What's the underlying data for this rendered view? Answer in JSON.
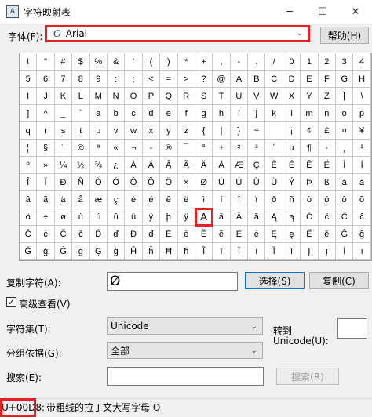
{
  "window": {
    "title": "字符映射表",
    "minimize": "─",
    "maximize": "☐",
    "close": "✕"
  },
  "font": {
    "label": "字体(F):",
    "icon_glyph": "O",
    "value": "Arial",
    "help_button": "帮助(H)"
  },
  "grid": {
    "selected_row": 9,
    "selected_col": 10,
    "rows": [
      [
        "!",
        "\"",
        "#",
        "$",
        "%",
        "&",
        "'",
        "(",
        ")",
        "*",
        "+",
        ",",
        "-",
        ".",
        "/",
        "0",
        "1",
        "2",
        "3",
        "4"
      ],
      [
        "5",
        "6",
        "7",
        "8",
        "9",
        ":",
        ";",
        "<",
        "=",
        ">",
        "?",
        "@",
        "A",
        "B",
        "C",
        "D",
        "E",
        "F",
        "G",
        "H"
      ],
      [
        "I",
        "J",
        "K",
        "L",
        "M",
        "N",
        "O",
        "P",
        "Q",
        "R",
        "S",
        "T",
        "U",
        "V",
        "W",
        "X",
        "Y",
        "Z",
        "[",
        "\\"
      ],
      [
        "]",
        "^",
        "_",
        "`",
        "a",
        "b",
        "c",
        "d",
        "e",
        "f",
        "g",
        "h",
        "i",
        "j",
        "k",
        "l",
        "m",
        "n",
        "o",
        "p"
      ],
      [
        "q",
        "r",
        "s",
        "t",
        "u",
        "v",
        "w",
        "x",
        "y",
        "z",
        "{",
        "|",
        "}",
        "~",
        " ",
        "¡",
        "¢",
        "£",
        "¤",
        "¥"
      ],
      [
        "¦",
        "§",
        "¨",
        "©",
        "ª",
        "«",
        "¬",
        "-",
        "®",
        "¯",
        "°",
        "±",
        "²",
        "³",
        "´",
        "µ",
        "¶",
        "·",
        "¸",
        "¹"
      ],
      [
        "º",
        "»",
        "¼",
        "½",
        "¾",
        "¿",
        "À",
        "Á",
        "Â",
        "Ã",
        "Ä",
        "Å",
        "Æ",
        "Ç",
        "È",
        "É",
        "Ê",
        "Ë",
        "Ì",
        "Í"
      ],
      [
        "Î",
        "Ï",
        "Ð",
        "Ñ",
        "Ò",
        "Ó",
        "Ô",
        "Õ",
        "Ö",
        "×",
        "Ø",
        "Ù",
        "Ú",
        "Û",
        "Ü",
        "Ý",
        "Þ",
        "ß",
        "à",
        "á"
      ],
      [
        "â",
        "ã",
        "ä",
        "å",
        "æ",
        "ç",
        "è",
        "é",
        "ê",
        "ë",
        "ì",
        "í",
        "î",
        "ï",
        "ð",
        "ñ",
        "ò",
        "ó",
        "ô",
        "õ"
      ],
      [
        "ö",
        "÷",
        "ø",
        "ù",
        "ú",
        "û",
        "ü",
        "ý",
        "þ",
        "ÿ",
        "Ā",
        "ā",
        "Ă",
        "ă",
        "Ą",
        "ą",
        "Ć",
        "ć",
        "Ĉ",
        "ĉ"
      ],
      [
        "Ċ",
        "ċ",
        "Č",
        "č",
        "Ď",
        "ď",
        "Đ",
        "đ",
        "Ē",
        "ē",
        "Ĕ",
        "ĕ",
        "Ė",
        "ė",
        "Ę",
        "ę",
        "Ě",
        "ě",
        "Ĝ",
        "ĝ"
      ],
      [
        "Ğ",
        "ğ",
        "Ġ",
        "ġ",
        "Ģ",
        "ģ",
        "Ĥ",
        "ĥ",
        "Ħ",
        "ħ",
        "Ĩ",
        "ĩ",
        "Ī",
        "ī",
        "Ĭ",
        "ĭ",
        "Į",
        "į",
        "İ",
        "ı"
      ]
    ]
  },
  "copy": {
    "label": "复制字符(A):",
    "value": "Ø",
    "select_button": "选择(S)",
    "copy_button": "复制(C)"
  },
  "advanced": {
    "label": "高级查看(V)",
    "checked": "✓"
  },
  "charset": {
    "label": "字符集(T):",
    "value": "Unicode"
  },
  "goto": {
    "label1": "转到",
    "label2": "Unicode(U):",
    "value": ""
  },
  "groupby": {
    "label": "分组依据(G):",
    "value": "全部"
  },
  "search": {
    "label": "搜索(E):",
    "value": "",
    "button": "搜索(R)"
  },
  "status": {
    "code": "U+00D8:",
    "description": "带粗线的拉丁文大写字母 O"
  }
}
